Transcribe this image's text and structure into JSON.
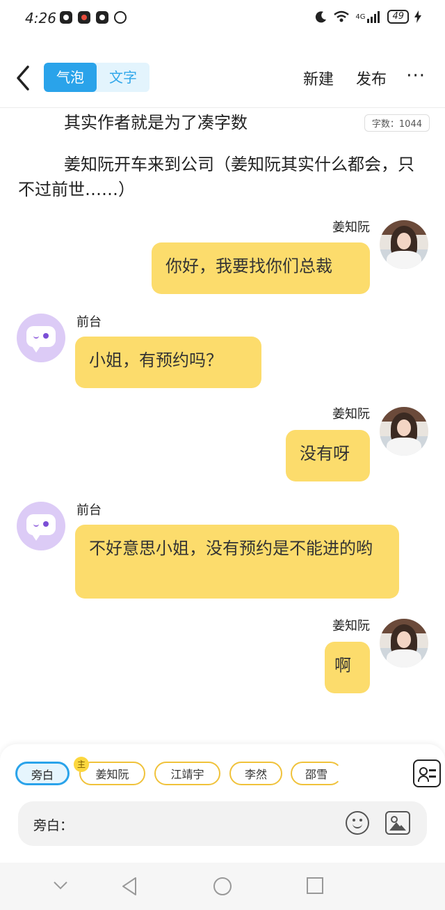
{
  "status_bar": {
    "time": "4:26",
    "network": "4G",
    "battery": "49"
  },
  "nav": {
    "tabs": [
      {
        "label": "气泡",
        "active": true
      },
      {
        "label": "文字",
        "active": false
      }
    ],
    "new_label": "新建",
    "publish_label": "发布",
    "more_label": "···"
  },
  "narration": [
    "其实作者就是为了凑字数",
    "姜知阮开车来到公司（姜知阮其实什么都会，只不过前世……）"
  ],
  "word_count": "字数：1044",
  "messages": [
    {
      "sender": "姜知阮",
      "side": "right",
      "text": "你好，我要找你们总裁"
    },
    {
      "sender": "前台",
      "side": "left",
      "text": "小姐，有预约吗？"
    },
    {
      "sender": "姜知阮",
      "side": "right",
      "text": "没有呀"
    },
    {
      "sender": "前台",
      "side": "left",
      "text": "不好意思小姐，没有预约是不能进的哟"
    },
    {
      "sender": "姜知阮",
      "side": "right",
      "text": "啊"
    }
  ],
  "characters": [
    {
      "label": "旁白",
      "active": true
    },
    {
      "label": "姜知阮",
      "active": false,
      "badge": "主"
    },
    {
      "label": "江靖宇",
      "active": false
    },
    {
      "label": "李然",
      "active": false
    },
    {
      "label": "邵雪",
      "active": false
    }
  ],
  "input": {
    "label": "旁白："
  },
  "colors": {
    "accent": "#2aa3ea",
    "bubble": "#fcdc6c",
    "chip_border": "#f0c23a",
    "bot_avatar": "#dccbf6"
  }
}
